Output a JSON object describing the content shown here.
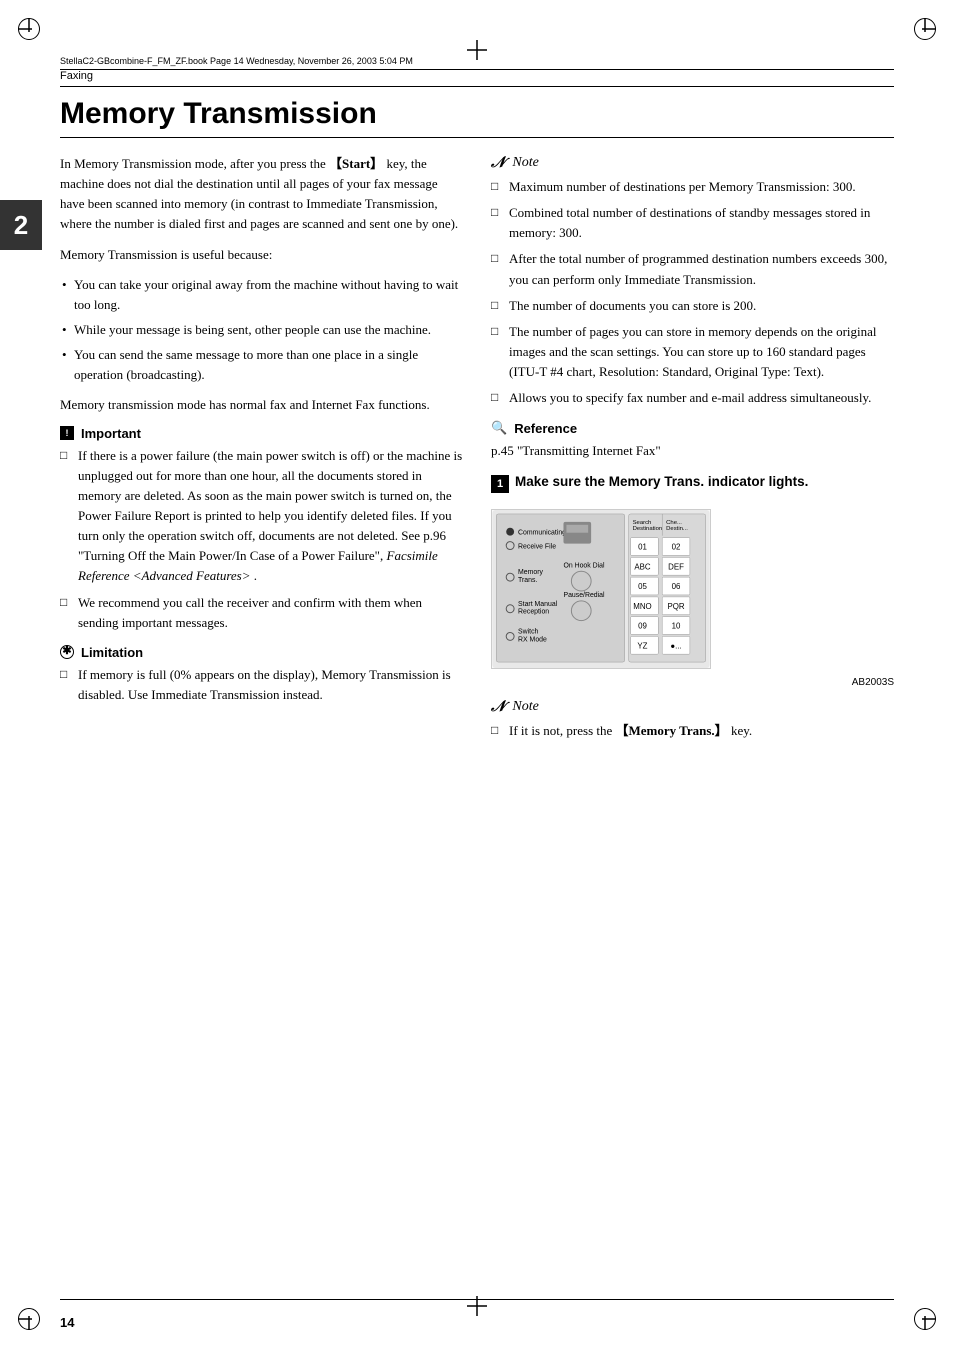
{
  "meta": {
    "file_path": "StellaC2-GBcombine-F_FM_ZF.book  Page 14  Wednesday, November 26, 2003  5:04 PM",
    "page_number": "14",
    "section_label": "Faxing",
    "chapter_number": "2"
  },
  "title": "Memory Transmission",
  "left_col": {
    "intro_para1": "In Memory Transmission mode, after you press the 【Start】 key, the machine does not dial the destination until all pages of your fax message have been scanned into memory (in contrast to Immediate Transmission, where the number is dialed first and pages are scanned and sent one by one).",
    "intro_para2": "Memory Transmission is useful because:",
    "bullets": [
      "You can take your original away from the machine without having to wait too long.",
      "While your message is being sent, other people can use the machine.",
      "You can send the same message to more than one place in a single operation (broadcasting)."
    ],
    "intro_para3": "Memory transmission mode has normal fax and Internet Fax functions.",
    "important_heading": "Important",
    "important_items": [
      "If there is a power failure (the main power switch is off) or the machine is unplugged out for more than one hour, all the documents stored in memory are deleted. As soon as the main power switch is turned on, the Power Failure Report is printed to help you identify deleted files. If you turn only the operation switch off, documents are not deleted. See p.96 \"Turning Off the Main Power/In Case of a Power Failure\", Facsimile Reference <Advanced Features> .",
      "We recommend you call the receiver and confirm with them when sending important messages."
    ],
    "limitation_heading": "Limitation",
    "limitation_items": [
      "If memory is full (0% appears on the display), Memory Transmission is disabled. Use Immediate Transmission instead."
    ]
  },
  "right_col": {
    "note1_heading": "Note",
    "note1_items": [
      "Maximum number of destinations per Memory Transmission: 300.",
      "Combined total number of destinations of standby messages stored in memory: 300.",
      "After the total number of programmed destination numbers exceeds 300, you can perform only Immediate Transmission.",
      "The number of documents you can store is 200.",
      "The number of pages you can store in memory depends on the original images and the scan settings. You can store up to 160 standard pages (ITU-T #4 chart, Resolution: Standard, Original Type: Text).",
      "Allows you to specify fax number and e-mail address simultaneously."
    ],
    "reference_heading": "Reference",
    "reference_text": "p.45 \"Transmitting Internet Fax\"",
    "step1_heading": "Make sure the Memory Trans. indicator lights.",
    "image_caption": "AB2003S",
    "note2_heading": "Note",
    "note2_items": [
      "If it is not, press the 【Memory Trans.】 key."
    ]
  }
}
